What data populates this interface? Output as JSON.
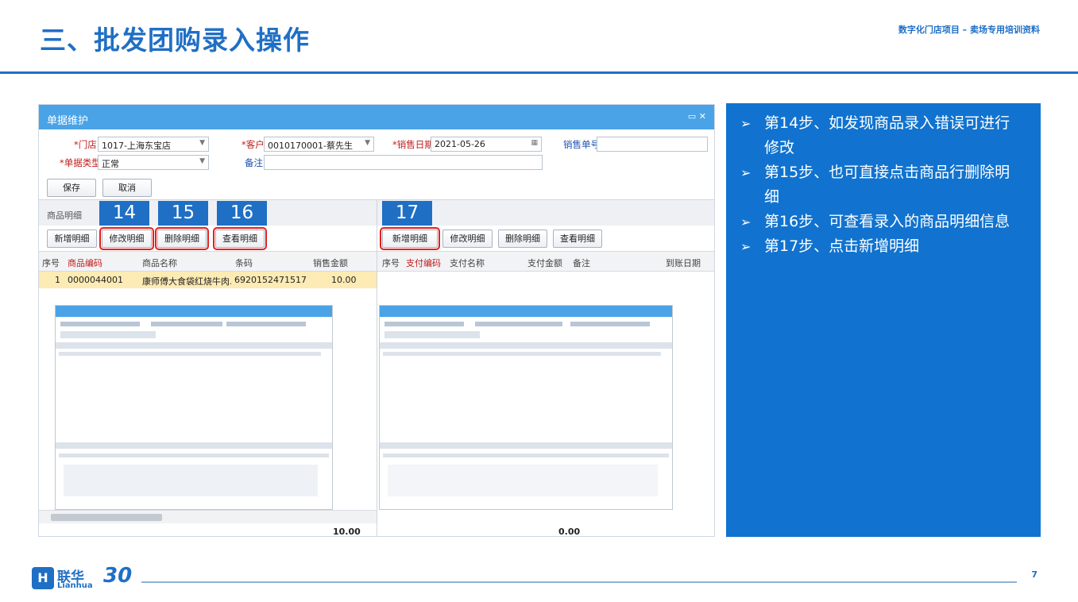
{
  "slide": {
    "title": "三、批发团购录入操作",
    "subtitle": "数字化门店项目 – 卖场专用培训资料",
    "page_number": "7"
  },
  "window": {
    "title": "单据维护",
    "controls": "▭ ✕",
    "form": {
      "store_label": "*门店:",
      "store_value": "1017-上海东宝店",
      "customer_label": "*客户:",
      "customer_value": "0010170001-蔡先生",
      "date_label": "*销售日期:",
      "date_value": "2021-05-26",
      "order_no_label": "销售单号:",
      "order_no_value": "",
      "type_label": "*单据类型:",
      "type_value": "正常",
      "remark_label": "备注:",
      "remark_value": ""
    },
    "save_button": "保存",
    "cancel_button": "取消",
    "section_label": "商品明细",
    "steps": [
      "14",
      "15",
      "16",
      "17"
    ],
    "left_toolbar": [
      "新增明细",
      "修改明细",
      "删除明细",
      "查看明细"
    ],
    "right_toolbar": [
      "新增明细",
      "修改明细",
      "删除明细",
      "查看明细"
    ],
    "left_columns": [
      "序号",
      "商品编码",
      "商品名称",
      "条码",
      "销售金额"
    ],
    "right_columns": [
      "序号",
      "支付编码",
      "支付名称",
      "支付金额",
      "备注",
      "到账日期"
    ],
    "rows": [
      {
        "seq": "1",
        "code": "0000044001",
        "name": "康师傅大食袋红烧牛肉...",
        "barcode": "6920152471517",
        "amount": "10.00"
      }
    ],
    "left_total": "10.00",
    "right_total": "0.00"
  },
  "panel": {
    "steps": [
      "第14步、如发现商品录入错误可进行修改",
      "第15步、也可直接点击商品行删除明细",
      "第16步、可查看录入的商品明细信息",
      "第17步、点击新增明细"
    ]
  },
  "logo": {
    "mark": "H",
    "name_cn": "联华",
    "name_en": "Lianhua",
    "years": "30"
  },
  "colors": {
    "brand": "#1f6fc5",
    "panel": "#1173cf",
    "highlight": "#e12020",
    "row_selected": "#fcebb4"
  }
}
